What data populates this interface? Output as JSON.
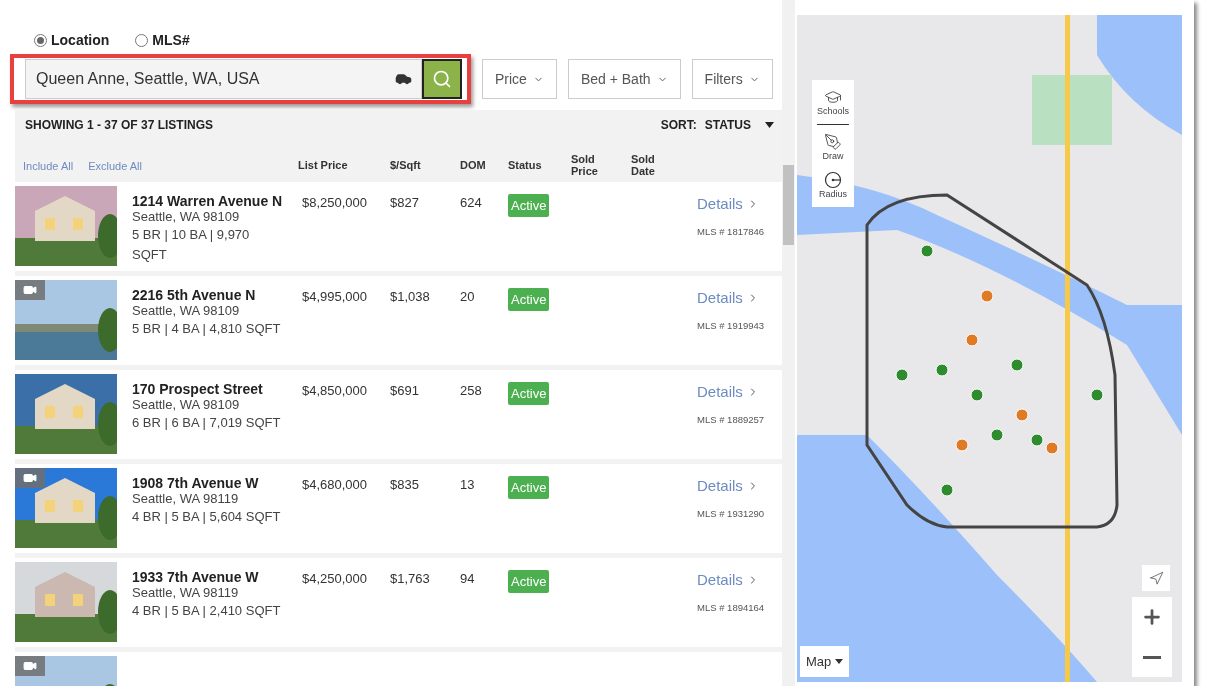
{
  "search_mode": [
    {
      "label": "Location",
      "selected": true
    },
    {
      "label": "MLS#",
      "selected": false
    }
  ],
  "search": {
    "value": "Queen Anne, Seattle, WA, USA",
    "highlighted": true
  },
  "filters": [
    "Price",
    "Bed + Bath",
    "Filters"
  ],
  "results": {
    "summary": "SHOWING 1 - 37 OF 37 LISTINGS",
    "sort_label": "SORT:",
    "sort_value": "STATUS"
  },
  "bulk_actions": [
    "Include All",
    "Exclude All"
  ],
  "columns": [
    "List Price",
    "$/Sqft",
    "DOM",
    "Status",
    "Sold Price",
    "Sold Date"
  ],
  "listings": [
    {
      "address": "1214 Warren Avenue N",
      "city": "Seattle, WA 98109",
      "specs": "5 BR | 10 BA | 9,970 SQFT",
      "price": "$8,250,000",
      "per_sqft": "$827",
      "dom": "624",
      "status": "Active",
      "details": "Details",
      "mls": "MLS # 1817846",
      "video": false
    },
    {
      "address": "2216 5th Avenue N",
      "city": "Seattle, WA 98109",
      "specs": "5 BR | 4 BA | 4,810 SQFT",
      "price": "$4,995,000",
      "per_sqft": "$1,038",
      "dom": "20",
      "status": "Active",
      "details": "Details",
      "mls": "MLS # 1919943",
      "video": true
    },
    {
      "address": "170 Prospect Street",
      "city": "Seattle, WA 98109",
      "specs": "6 BR | 6 BA | 7,019 SQFT",
      "price": "$4,850,000",
      "per_sqft": "$691",
      "dom": "258",
      "status": "Active",
      "details": "Details",
      "mls": "MLS # 1889257",
      "video": false
    },
    {
      "address": "1908 7th Avenue W",
      "city": "Seattle, WA 98119",
      "specs": "4 BR | 5 BA | 5,604 SQFT",
      "price": "$4,680,000",
      "per_sqft": "$835",
      "dom": "13",
      "status": "Active",
      "details": "Details",
      "mls": "MLS # 1931290",
      "video": true
    },
    {
      "address": "1933 7th Avenue W",
      "city": "Seattle, WA 98119",
      "specs": "4 BR | 5 BA | 2,410 SQFT",
      "price": "$4,250,000",
      "per_sqft": "$1,763",
      "dom": "94",
      "status": "Active",
      "details": "Details",
      "mls": "MLS # 1894164",
      "video": false
    }
  ],
  "partial_listing": {
    "video": true
  },
  "map": {
    "tools": [
      "Schools",
      "Draw",
      "Radius"
    ],
    "type_menu": "Map"
  }
}
